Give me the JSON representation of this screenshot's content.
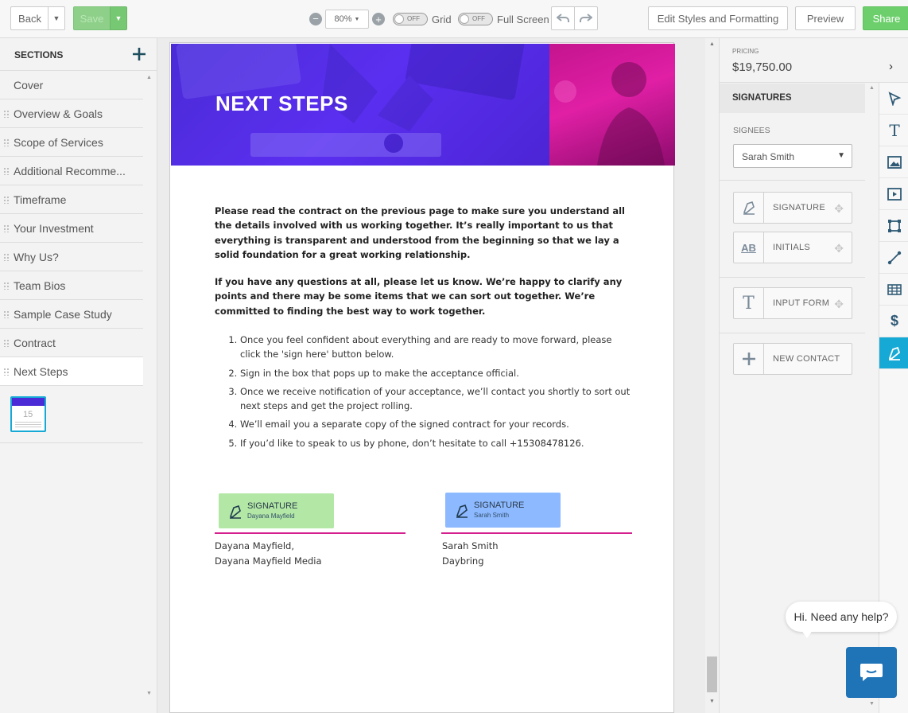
{
  "topbar": {
    "back_label": "Back",
    "save_label": "Save",
    "zoom": "80%",
    "grid_label": "Grid",
    "grid_toggle": "OFF",
    "fullscreen_label": "Full Screen",
    "fullscreen_toggle": "OFF",
    "edit_styles_label": "Edit Styles and Formatting",
    "preview_label": "Preview",
    "share_label": "Share"
  },
  "sidebar": {
    "heading": "SECTIONS",
    "items": [
      {
        "label": "Cover"
      },
      {
        "label": "Overview & Goals"
      },
      {
        "label": "Scope of Services"
      },
      {
        "label": "Additional Recomme..."
      },
      {
        "label": "Timeframe"
      },
      {
        "label": "Your Investment"
      },
      {
        "label": "Why Us?"
      },
      {
        "label": "Team Bios"
      },
      {
        "label": "Sample Case Study"
      },
      {
        "label": "Contract"
      },
      {
        "label": "Next Steps"
      }
    ],
    "thumb_number": "15"
  },
  "page": {
    "title": "NEXT STEPS",
    "para1": "Please read the contract on the previous page to make sure you understand all the details involved with us working together. It’s really important to us that everything is transparent and understood from the beginning so that we lay a solid foundation for a great working relationship.",
    "para2": "If you have any questions at all, please let us know. We’re happy to clarify any points and there may be some items that we can sort out together. We’re committed to finding the best way to work together.",
    "steps": [
      "Once you feel confident about everything and are ready to move forward, please click the 'sign here' button below.",
      "Sign in the box that pops up to make the acceptance official.",
      "Once we receive notification of your acceptance, we’ll contact you shortly to sort out next steps and get the project rolling.",
      "We’ll email you a separate copy of the signed contract for your records.",
      "If you’d like to speak to us by phone, don’t hesitate to call +15308478126."
    ],
    "sig1": {
      "title": "SIGNATURE",
      "name": "Dayana Mayfield",
      "line1": "Dayana Mayfield,",
      "line2": "Dayana Mayfield Media",
      "color": "#b2e7a6"
    },
    "sig2": {
      "title": "SIGNATURE",
      "name": "Sarah Smith",
      "line1": "Sarah Smith",
      "line2": "Daybring",
      "color": "#8cb9ff"
    }
  },
  "right": {
    "pricing_label": "PRICING",
    "pricing_value": "$19,750.00",
    "section_title": "SIGNATURES",
    "signees_label": "SIGNEES",
    "signee_selected": "Sarah Smith",
    "buttons": {
      "signature": "SIGNATURE",
      "initials": "INITIALS",
      "initials_icon": "AB",
      "input_form": "INPUT FORM",
      "new_contact": "NEW CONTACT"
    }
  },
  "chat": {
    "bubble": "Hi. Need any help?"
  },
  "colors": {
    "accent": "#17a9d6",
    "share": "#6ccf6c",
    "save": "#8ed08a",
    "line": "#d61f8f"
  }
}
